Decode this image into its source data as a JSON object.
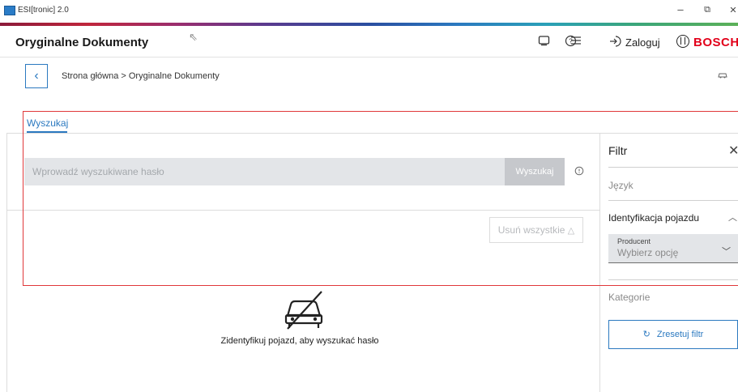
{
  "window": {
    "title": "ESI[tronic] 2.0",
    "controls": {
      "minimize": "–",
      "restore": "⧉",
      "close": "✕"
    }
  },
  "header": {
    "title": "Oryginalne Dokumenty",
    "login_label": "Zaloguj",
    "brand": "BOSCH",
    "icons": [
      "screen-icon",
      "help-icon",
      "menu-icon",
      "login-icon"
    ]
  },
  "breadcrumb": {
    "text": "Strona główna > Oryginalne Dokumenty"
  },
  "tabs": [
    {
      "label": "Wyszukaj",
      "active": true
    }
  ],
  "search": {
    "placeholder": "Wprowadź wyszukiwane hasło",
    "value": "",
    "button_label": "Wyszukaj"
  },
  "actions": {
    "clear_all_label": "Usuń wszystkie"
  },
  "empty_state": {
    "message": "Zidentyfikuj pojazd, aby wyszukać hasło"
  },
  "filter": {
    "title": "Filtr",
    "language_label": "Język",
    "vehicle_section_label": "Identyfikacja pojazdu",
    "producer": {
      "label": "Producent",
      "value": "Wybierz opcję"
    },
    "category_label": "Kategorie",
    "reset_label": "Zresetuj filtr"
  },
  "colors": {
    "accent": "#2b79c0",
    "brand": "#e2001a",
    "highlight": "#e0383a"
  }
}
